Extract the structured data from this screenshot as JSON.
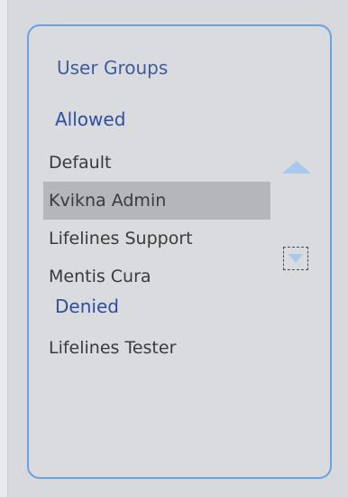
{
  "panel": {
    "title": "User Groups"
  },
  "allowed": {
    "label": "Allowed",
    "items": [
      {
        "label": "Default",
        "selected": false
      },
      {
        "label": "Kvikna Admin",
        "selected": true
      },
      {
        "label": "Lifelines Support",
        "selected": false
      },
      {
        "label": "Mentis Cura",
        "selected": false
      }
    ]
  },
  "denied": {
    "label": "Denied",
    "items": [
      {
        "label": "Lifelines Tester",
        "selected": false
      }
    ]
  },
  "controls": {
    "move_up_icon": "triangle-up-icon",
    "move_down_icon": "triangle-down-icon"
  },
  "colors": {
    "border": "#6aa2de",
    "heading": "#3e5d9c",
    "section": "#2f4f9e",
    "selection": "#b4b6ba",
    "arrow": "#a9c8ec"
  }
}
